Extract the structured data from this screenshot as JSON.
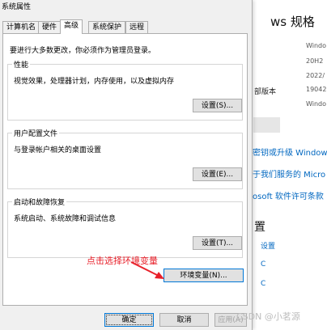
{
  "background": {
    "title": "ws 规格",
    "info": [
      "Windo",
      "20H2",
      "2022/",
      "19042.",
      "Windo"
    ],
    "labels": [
      "部版本"
    ],
    "links": [
      "密钥或升级 Window",
      "于我们服务的 Micro",
      "osoft 软件许可条款"
    ],
    "section_title": "置",
    "small_links": [
      "设置",
      "C",
      "C"
    ]
  },
  "dialog": {
    "title": "系统属性",
    "tabs": [
      "计算机名",
      "硬件",
      "高级",
      "系统保护",
      "远程"
    ],
    "active_tab": "高级",
    "intro": "要进行大多数更改，你必须作为管理员登录。",
    "groups": [
      {
        "title": "性能",
        "desc": "视觉效果，处理器计划，内存使用，以及虚拟内存",
        "button": "设置(S)..."
      },
      {
        "title": "用户配置文件",
        "desc": "与登录帐户相关的桌面设置",
        "button": "设置(E)..."
      },
      {
        "title": "启动和故障恢复",
        "desc": "系统启动、系统故障和调试信息",
        "button": "设置(T)..."
      }
    ],
    "env_button": "环境变量(N)...",
    "ok_button": "确定",
    "cancel_button": "取消",
    "apply_button": "应用(A)"
  },
  "annotation": "点击选择环境变量",
  "watermark": "CSDN @小茗源",
  "colors": {
    "annotation": "#e8202a",
    "link": "#0067c0",
    "focus_border": "#0078d7"
  }
}
